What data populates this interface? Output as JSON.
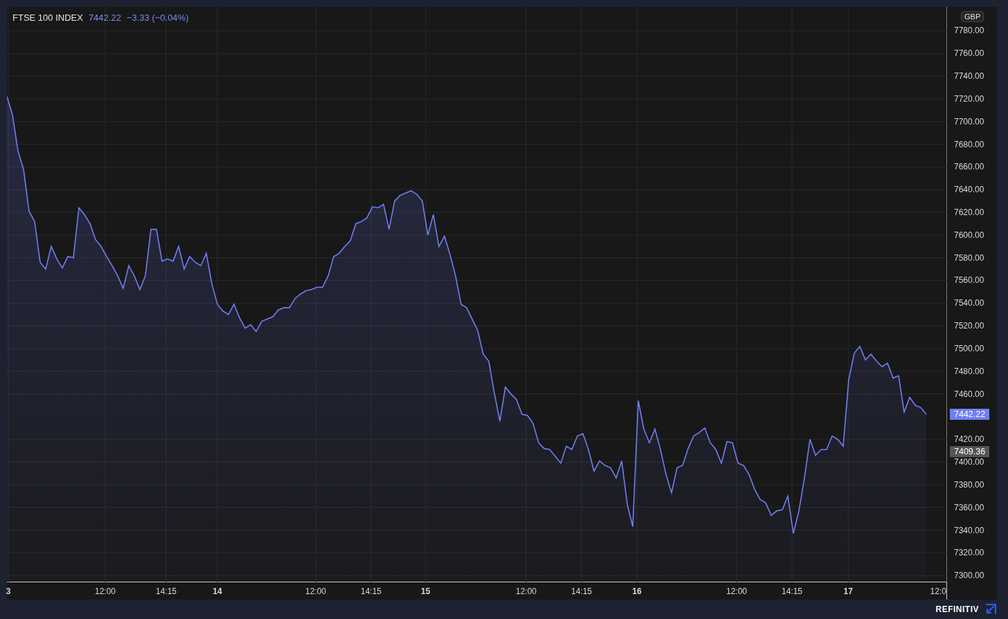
{
  "legend": {
    "price": "7442.22",
    "change": "−3.33 (−0.04%)"
  },
  "y_axis": {
    "currency": "GBP",
    "tags": [
      {
        "label": "7442.22",
        "kind": "last"
      },
      {
        "label": "7409.36",
        "kind": "close"
      }
    ]
  },
  "chart_data": {
    "type": "area",
    "grid": true,
    "ylim": [
      7294,
      7801
    ],
    "yticks": [
      {
        "value": 7300,
        "label": "7300.00"
      },
      {
        "value": 7320,
        "label": "7320.00"
      },
      {
        "value": 7340,
        "label": "7340.00"
      },
      {
        "value": 7360,
        "label": "7360.00"
      },
      {
        "value": 7380,
        "label": "7380.00"
      },
      {
        "value": 7400,
        "label": "7400.00"
      },
      {
        "value": 7420,
        "label": "7420.00"
      },
      {
        "value": 7460,
        "label": "7460.00"
      },
      {
        "value": 7480,
        "label": "7480.00"
      },
      {
        "value": 7500,
        "label": "7500.00"
      },
      {
        "value": 7520,
        "label": "7520.00"
      },
      {
        "value": 7540,
        "label": "7540.00"
      },
      {
        "value": 7560,
        "label": "7560.00"
      },
      {
        "value": 7580,
        "label": "7580.00"
      },
      {
        "value": 7600,
        "label": "7600.00"
      },
      {
        "value": 7620,
        "label": "7620.00"
      },
      {
        "value": 7640,
        "label": "7640.00"
      },
      {
        "value": 7660,
        "label": "7660.00"
      },
      {
        "value": 7680,
        "label": "7680.00"
      },
      {
        "value": 7700,
        "label": "7700.00"
      },
      {
        "value": 7720,
        "label": "7720.00"
      },
      {
        "value": 7740,
        "label": "7740.00"
      },
      {
        "value": 7760,
        "label": "7760.00"
      },
      {
        "value": 7780,
        "label": "7780.00"
      }
    ],
    "categories": [
      null,
      null,
      null,
      null,
      null,
      null,
      null,
      null,
      null,
      null,
      null,
      null,
      null,
      null,
      null,
      null,
      null,
      null,
      null,
      null,
      null,
      null,
      null,
      null,
      null,
      null,
      null,
      null,
      null,
      null,
      null,
      null,
      null,
      null,
      null,
      null,
      null,
      null,
      null,
      null,
      null,
      null,
      null,
      null,
      null,
      null,
      null,
      null,
      null,
      null,
      null,
      null,
      null,
      null,
      null,
      null,
      null,
      null,
      null,
      null,
      null,
      null,
      null,
      null,
      null,
      null,
      null,
      null,
      null,
      null,
      null,
      null,
      null,
      null,
      null,
      null,
      null,
      null,
      null,
      null,
      null,
      null,
      null,
      null,
      null,
      null,
      null,
      null,
      null,
      null,
      null,
      null,
      null,
      null,
      null,
      null,
      null,
      null,
      null,
      null,
      null,
      null,
      null,
      null,
      null,
      null,
      null,
      null,
      null,
      null,
      null,
      null,
      null,
      null,
      null,
      null,
      null,
      null,
      null,
      null,
      null,
      null,
      null,
      null,
      null,
      null,
      null,
      null,
      null,
      null,
      null,
      null,
      null,
      null,
      null,
      null,
      null,
      null,
      null,
      null,
      null,
      null,
      null,
      null,
      null,
      null,
      null,
      null,
      null,
      null,
      null,
      null,
      null,
      null,
      null,
      null,
      null,
      null,
      null,
      null,
      null,
      null,
      null,
      null,
      null,
      null,
      null
    ],
    "series": [
      {
        "name": "FTSE 100 INDEX",
        "color": "#6f7ff5",
        "values": [
          7722,
          7706,
          7674,
          7658,
          7621,
          7612,
          7576,
          7570,
          7590,
          7579,
          7571,
          7581,
          7580,
          7624,
          7618,
          7610,
          7596,
          7590,
          7581,
          7573,
          7564,
          7553,
          7573,
          7564,
          7552,
          7564,
          7605,
          7605,
          7577,
          7579,
          7577,
          7590,
          7570,
          7581,
          7576,
          7573,
          7584,
          7557,
          7539,
          7533,
          7530,
          7539,
          7527,
          7518,
          7521,
          7515,
          7524,
          7526,
          7528,
          7534,
          7536,
          7536,
          7544,
          7548,
          7551,
          7552,
          7554,
          7554,
          7564,
          7581,
          7584,
          7590,
          7595,
          7610,
          7612,
          7615,
          7625,
          7624,
          7627,
          7605,
          7630,
          7635,
          7637,
          7639,
          7636,
          7630,
          7600,
          7618,
          7590,
          7599,
          7583,
          7564,
          7539,
          7536,
          7526,
          7516,
          7495,
          7489,
          7461,
          7436,
          7466,
          7460,
          7455,
          7442,
          7441,
          7434,
          7417,
          7412,
          7411,
          7405,
          7399,
          7414,
          7411,
          7423,
          7425,
          7411,
          7392,
          7401,
          7397,
          7395,
          7386,
          7401,
          7363,
          7343,
          7454,
          7429,
          7417,
          7429,
          7411,
          7389,
          7373,
          7395,
          7397,
          7412,
          7423,
          7426,
          7430,
          7417,
          7411,
          7399,
          7418,
          7417,
          7399,
          7397,
          7389,
          7376,
          7367,
          7364,
          7353,
          7357,
          7358,
          7370,
          7337,
          7357,
          7386,
          7420,
          7406,
          7411,
          7411,
          7423,
          7420,
          7414,
          7473,
          7496,
          7502,
          7490,
          7495,
          7489,
          7484,
          7487,
          7474,
          7476,
          7444,
          7457,
          7450,
          7448,
          7442
        ]
      }
    ]
  },
  "x_axis": {
    "labels": [
      {
        "label": "3",
        "kind": "day"
      },
      {
        "label": "12:00",
        "kind": "time"
      },
      {
        "label": "14:15",
        "kind": "time"
      },
      {
        "label": "14",
        "kind": "day"
      },
      {
        "label": "12:00",
        "kind": "time"
      },
      {
        "label": "14:15",
        "kind": "time"
      },
      {
        "label": "15",
        "kind": "day"
      },
      {
        "label": "12:00",
        "kind": "time"
      },
      {
        "label": "14:15",
        "kind": "time"
      },
      {
        "label": "16",
        "kind": "day"
      },
      {
        "label": "12:00",
        "kind": "time"
      },
      {
        "label": "14:15",
        "kind": "time"
      },
      {
        "label": "17",
        "kind": "day"
      },
      {
        "label": "12:0",
        "kind": "time"
      }
    ]
  },
  "footer": {
    "brand": "REFINITIV"
  }
}
